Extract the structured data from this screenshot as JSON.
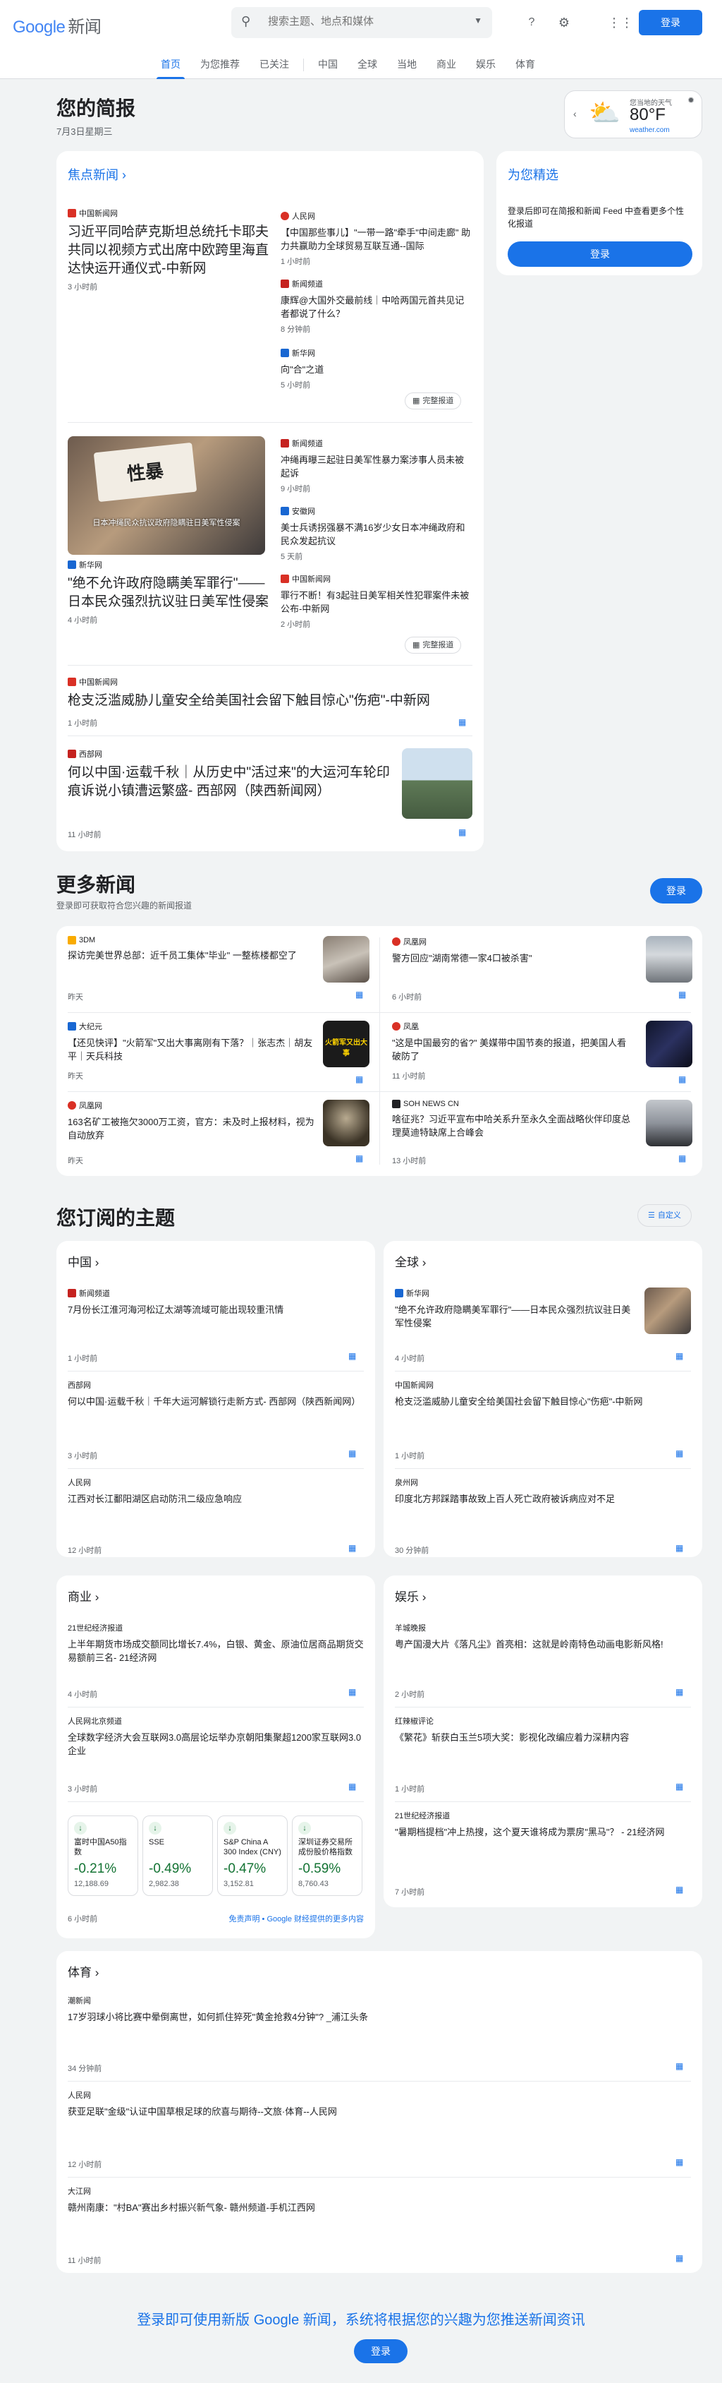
{
  "header": {
    "logo_google": "Google",
    "logo_news": "新闻",
    "search_placeholder": "搜索主题、地点和媒体",
    "signin": "登录"
  },
  "nav": [
    "首页",
    "为您推荐",
    "已关注",
    "中国",
    "全球",
    "当地",
    "商业",
    "娱乐",
    "体育"
  ],
  "briefing": {
    "title": "您的简报",
    "date": "7月3日星期三"
  },
  "weather": {
    "label": "您当地的天气",
    "temp": "80°F",
    "source": "weather.com"
  },
  "top": {
    "title": "焦点新闻",
    "full_coverage": "完整报道"
  },
  "cluster1": {
    "main": {
      "source": "中国新闻网",
      "title": "习近平同哈萨克斯坦总统托卡耶夫共同以视频方式出席中欧跨里海直达快运开通仪式-中新网",
      "time": "3 小时前"
    },
    "items": [
      {
        "source": "人民网",
        "title": "【中国那些事儿】\"一带一路\"牵手\"中间走廊\" 助力共赢助力全球贸易互联互通--国际",
        "time": "1 小时前"
      },
      {
        "source": "新闻频道",
        "title": "康辉@大国外交最前线｜中哈两国元首共见记者都说了什么？",
        "time": "8 分钟前"
      },
      {
        "source": "新华网",
        "title": "向\"合\"之道",
        "time": "5 小时前"
      }
    ]
  },
  "cluster2": {
    "main": {
      "source": "新华网",
      "title": "\"绝不允许政府隐瞒美军罪行\"——日本民众强烈抗议驻日美军性侵案",
      "time": "4 小时前",
      "img_caption": "日本冲绳民众抗议政府隐瞒驻日美军性侵案"
    },
    "items": [
      {
        "source": "新闻频道",
        "title": "冲绳再曝三起驻日美军性暴力案涉事人员未被起诉",
        "time": "9 小时前"
      },
      {
        "source": "安徽网",
        "title": "美士兵诱拐强暴不满16岁少女日本冲绳政府和民众发起抗议",
        "time": "5 天前"
      },
      {
        "source": "中国新闻网",
        "title": "罪行不断！有3起驻日美军相关性犯罪案件未被公布-中新网",
        "time": "2 小时前"
      }
    ]
  },
  "single1": {
    "source": "中国新闻网",
    "title": "枪支泛滥威胁儿童安全给美国社会留下触目惊心\"伤疤\"-中新网",
    "time": "1 小时前"
  },
  "single2": {
    "source": "西部网",
    "title": "何以中国·运载千秋｜从历史中\"活过来\"的大运河车轮印痕诉说小镇漕运繁盛- 西部网（陕西新闻网）",
    "time": "11 小时前"
  },
  "picks": {
    "title": "为您精选",
    "text": "登录后即可在简报和新闻 Feed 中查看更多个性化报道",
    "button": "登录"
  },
  "more": {
    "title": "更多新闻",
    "sub": "登录即可获取符合您兴趣的新闻报道",
    "button": "登录",
    "items": [
      {
        "source": "3DM",
        "title": "探访完美世界总部：近千员工集体\"毕业\" 一整栋楼都空了",
        "time": "昨天"
      },
      {
        "source": "凤凰网",
        "title": "警方回应\"湖南常德一家4口被杀害\"",
        "time": "6 小时前"
      },
      {
        "source": "大纪元",
        "title": "【还见快评】\"火箭军\"又出大事离刚有下落？｜张志杰｜胡友平｜天兵科技",
        "time": "昨天",
        "img_text": "火箭军又出大事"
      },
      {
        "source": "凤凰",
        "title": "\"这是中国最穷的省?\" 美媒带中国节奏的报道，把美国人看破防了",
        "time": "11 小时前"
      },
      {
        "source": "凤凰网",
        "title": "163名矿工被拖欠3000万工资，官方：未及时上报材料，视为自动放弃",
        "time": "昨天"
      },
      {
        "source": "SOH NEWS CN",
        "title": "啥征兆？习近平宣布中哈关系升至永久全面战略伙伴印度总理莫迪特缺席上合峰会",
        "time": "13 小时前"
      }
    ]
  },
  "topics": {
    "title": "您订阅的主题",
    "customize": "自定义",
    "china": {
      "title": "中国",
      "items": [
        {
          "source": "新闻频道",
          "title": "7月份长江淮河海河松辽太湖等流域可能出现较重汛情",
          "time": "1 小时前"
        },
        {
          "source": "西部网",
          "title": "何以中国·运载千秋｜千年大运河解锁行走新方式- 西部网（陕西新闻网）",
          "time": "3 小时前"
        },
        {
          "source": "人民网",
          "title": "江西对长江鄱阳湖区启动防汛二级应急响应",
          "time": "12 小时前"
        }
      ]
    },
    "world": {
      "title": "全球",
      "items": [
        {
          "source": "新华网",
          "title": "\"绝不允许政府隐瞒美军罪行\"——日本民众强烈抗议驻日美军性侵案",
          "time": "4 小时前"
        },
        {
          "source": "中国新闻网",
          "title": "枪支泛滥威胁儿童安全给美国社会留下触目惊心\"伤疤\"-中新网",
          "time": "1 小时前"
        },
        {
          "source": "泉州网",
          "title": "印度北方邦踩踏事故致上百人死亡政府被诉病应对不足",
          "time": "30 分钟前"
        }
      ]
    },
    "business": {
      "title": "商业",
      "items": [
        {
          "source": "21世纪经济报道",
          "title": "上半年期货市场成交额同比增长7.4%，白银、黄金、原油位居商品期货交易额前三名- 21经济网",
          "time": "4 小时前"
        },
        {
          "source": "人民网北京频道",
          "title": "全球数字经济大会互联网3.0高层论坛举办京朝阳集聚超1200家互联网3.0企业",
          "time": "3 小时前"
        }
      ],
      "stocks": [
        {
          "name": "富时中国A50指数",
          "change": "-0.21%",
          "price": "12,188.69"
        },
        {
          "name": "SSE",
          "change": "-0.49%",
          "price": "2,982.38"
        },
        {
          "name": "S&P China A 300 Index (CNY)",
          "change": "-0.47%",
          "price": "3,152.81"
        },
        {
          "name": "深圳证券交易所成份股价格指数",
          "change": "-0.59%",
          "price": "8,760.43"
        }
      ],
      "stocks_time": "6 小时前",
      "disclaimer": "免责声明 • Google 财经提供的更多内容"
    },
    "ent": {
      "title": "娱乐",
      "items": [
        {
          "source": "羊城晚报",
          "title": "粤产国漫大片《落凡尘》首亮相：这就是岭南特色动画电影新风格!",
          "time": "2 小时前"
        },
        {
          "source": "红辣椒评论",
          "title": "《繁花》斩获白玉兰5项大奖：影视化改编应着力深耕内容",
          "time": "1 小时前"
        },
        {
          "source": "21世纪经济报道",
          "title": "\"暑期档提档\"冲上热搜，这个夏天谁将成为票房\"黑马\"？ - 21经济网",
          "time": "7 小时前"
        }
      ]
    },
    "sports": {
      "title": "体育",
      "items": [
        {
          "source": "潮新闻",
          "title": "17岁羽球小将比赛中晕倒离世，如何抓住猝死\"黄金抢救4分钟\"? _浦江头条",
          "time": "34 分钟前"
        },
        {
          "source": "人民网",
          "title": "获亚足联\"金级\"认证中国草根足球的欣喜与期待--文旅·体育--人民网",
          "time": "12 小时前"
        },
        {
          "source": "大江网",
          "title": "赣州南康：\"村BA\"赛出乡村振兴新气象- 赣州频道-手机江西网",
          "time": "11 小时前"
        }
      ]
    }
  },
  "footer": {
    "text": "登录即可使用新版 Google 新闻，系统将根据您的兴趣为您推送新闻资讯",
    "button": "登录"
  },
  "colors": {
    "accent": "#1a73e8",
    "up": "#137333"
  }
}
